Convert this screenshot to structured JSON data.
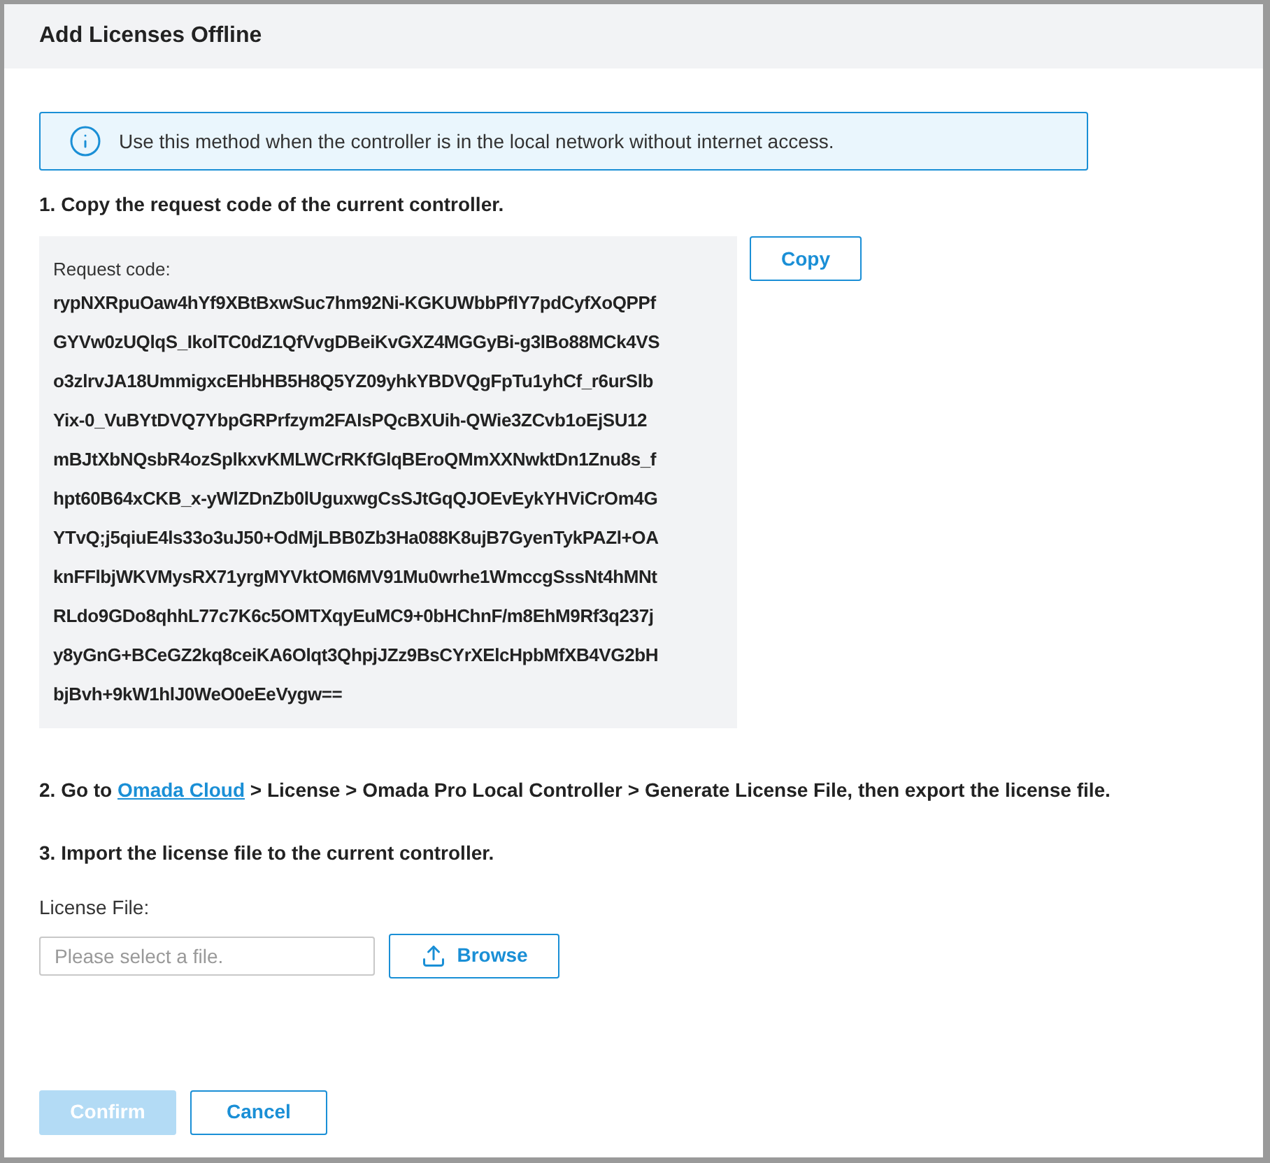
{
  "dialog": {
    "title": "Add Licenses Offline"
  },
  "info": {
    "text": "Use this method when the controller is in the local network without internet access."
  },
  "step1": {
    "heading": "1. Copy the request code of the current controller.",
    "code_label": "Request code:",
    "code_lines": [
      "rypNXRpuOaw4hYf9XBtBxwSuc7hm92Ni-KGKUWbbPflY7pdCyfXoQPPf",
      "GYVw0zUQlqS_IkolTC0dZ1QfVvgDBeiKvGXZ4MGGyBi-g3lBo88MCk4VS",
      "o3zlrvJA18UmmigxcEHbHB5H8Q5YZ09yhkYBDVQgFpTu1yhCf_r6urSlb",
      "Yix-0_VuBYtDVQ7YbpGRPrfzym2FAIsPQcBXUih-QWie3ZCvb1oEjSU12",
      "mBJtXbNQsbR4ozSplkxvKMLWCrRKfGlqBEroQMmXXNwktDn1Znu8s_f",
      "hpt60B64xCKB_x-yWlZDnZb0lUguxwgCsSJtGqQJOEvEykYHViCrOm4G",
      "YTvQ;j5qiuE4ls33o3uJ50+OdMjLBB0Zb3Ha088K8ujB7GyenTykPAZl+OA",
      "knFFlbjWKVMysRX71yrgMYVktOM6MV91Mu0wrhe1WmccgSssNt4hMNt",
      "RLdo9GDo8qhhL77c7K6c5OMTXqyEuMC9+0bHChnF/m8EhM9Rf3q237j",
      "y8yGnG+BCeGZ2kq8ceiKA6Olqt3QhpjJZz9BsCYrXElcHpbMfXB4VG2bH",
      "bjBvh+9kW1hlJ0WeO0eEeVygw=="
    ],
    "copy_button": "Copy"
  },
  "step2": {
    "prefix": "2. Go to ",
    "link": "Omada Cloud",
    "suffix": " > License > Omada Pro Local Controller > Generate License File, then export the license file."
  },
  "step3": {
    "heading": "3. Import the license file to the current controller.",
    "field_label": "License File:",
    "placeholder": "Please select a file.",
    "browse_button": "Browse"
  },
  "footer": {
    "buttons": [
      {
        "label": "Confirm",
        "kind": "primary",
        "disabled": true
      },
      {
        "label": "Cancel",
        "kind": "secondary",
        "disabled": false
      }
    ]
  }
}
